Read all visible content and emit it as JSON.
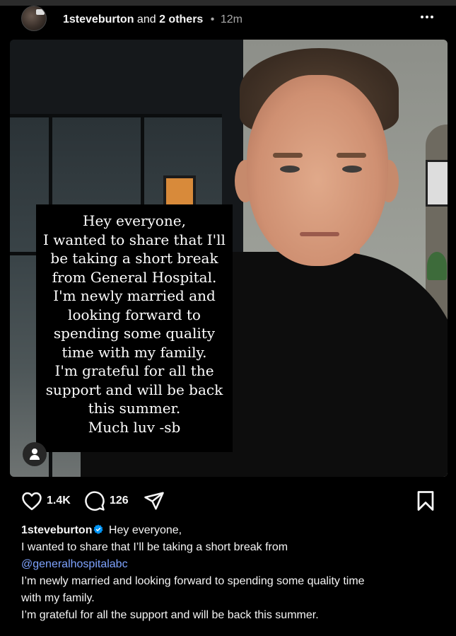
{
  "header": {
    "username": "1steveburton",
    "and_text": "and",
    "others": "2 others",
    "separator": "•",
    "time": "12m",
    "more_icon": "more-horizontal-icon"
  },
  "media": {
    "overlay_lines": [
      "Hey everyone,",
      "I wanted to share that I'll",
      "be taking a short break",
      "from General Hospital.",
      "I'm newly married and",
      "looking forward to",
      "spending some quality",
      "time with my family.",
      "I'm grateful for all the",
      "support and will be back",
      "this summer.",
      "Much luv -sb"
    ],
    "tag_icon": "person-tag-icon"
  },
  "actions": {
    "likes": "1.4K",
    "comments": "126",
    "like_icon": "heart-icon",
    "comment_icon": "comment-icon",
    "share_icon": "share-icon",
    "save_icon": "bookmark-icon"
  },
  "caption": {
    "username": "1steveburton",
    "line1": "Hey everyone,",
    "line2": "I wanted to share that I’ll be taking a short break from",
    "mention": "@generalhospitalabc",
    "line4": "I’m newly married and looking forward to spending some quality time",
    "line5": "with my family.",
    "line6": "I’m grateful for all the support and will be back this summer."
  },
  "colors": {
    "background": "#000000",
    "text": "#f5f5f5",
    "muted": "#a8a8a8",
    "link": "#7ea3ff",
    "verified": "#0095f6"
  }
}
